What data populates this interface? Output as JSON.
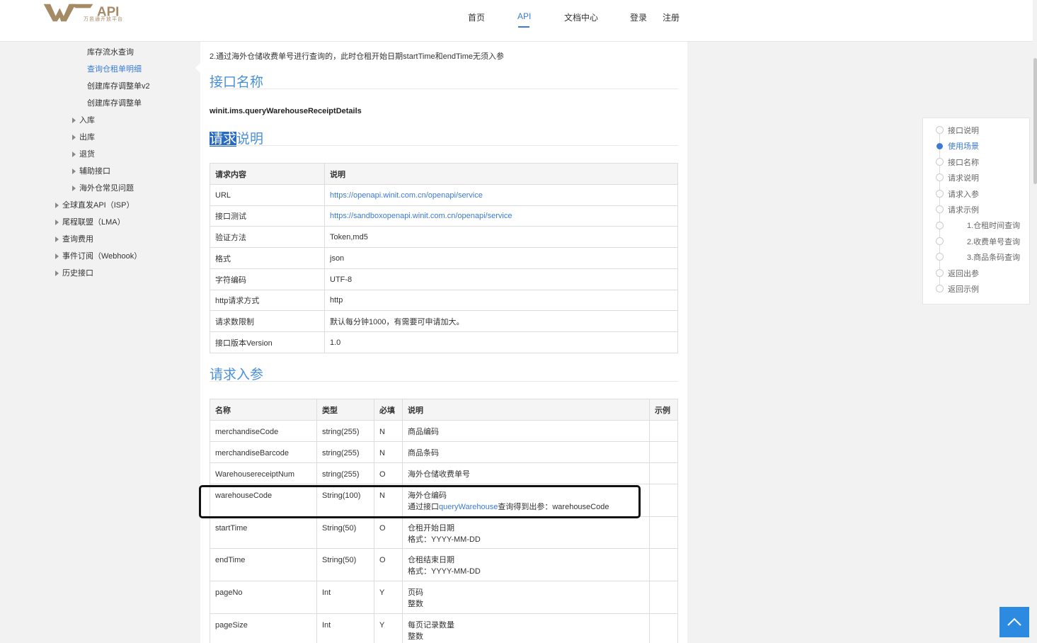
{
  "header": {
    "logo_text": "API",
    "logo_subtitle": "万邑通开放平台",
    "nav": [
      "首页",
      "API",
      "文档中心",
      "登录",
      "注册"
    ]
  },
  "sidebar": {
    "items": [
      {
        "label": "库存流水查询",
        "level": 3
      },
      {
        "label": "查询仓租单明细",
        "level": 3,
        "active": true
      },
      {
        "label": "创建库存调整单v2",
        "level": 3
      },
      {
        "label": "创建库存调整单",
        "level": 3
      },
      {
        "label": "入库",
        "level": 2
      },
      {
        "label": "出库",
        "level": 2
      },
      {
        "label": "退货",
        "level": 2
      },
      {
        "label": "辅助接口",
        "level": 2
      },
      {
        "label": "海外仓常见问题",
        "level": 2
      },
      {
        "label": "全球直发API（ISP）",
        "level": 1
      },
      {
        "label": "尾程联盟（LMA）",
        "level": 1
      },
      {
        "label": "查询费用",
        "level": 1
      },
      {
        "label": "事件订阅（Webhook）",
        "level": 1
      },
      {
        "label": "历史接口",
        "level": 1
      }
    ]
  },
  "content": {
    "intro": "2.通过海外仓储收费单号进行查询的，此时仓租开始日期startTime和endTime无须入参",
    "section_api_name": "接口名称",
    "api_name": "winit.ims.queryWarehouseReceiptDetails",
    "section_request_selected": "请求",
    "section_request_rest": "说明",
    "request_table": {
      "headers": [
        "请求内容",
        "说明"
      ],
      "rows": [
        [
          "URL",
          "https://openapi.winit.com.cn/openapi/service"
        ],
        [
          "接口测试",
          "https://sandboxopenapi.winit.com.cn/openapi/service"
        ],
        [
          "验证方法",
          "Token,md5"
        ],
        [
          "格式",
          "json"
        ],
        [
          "字符编码",
          "UTF-8"
        ],
        [
          "http请求方式",
          "http"
        ],
        [
          "请求数限制",
          "默认每分钟1000，有需要可申请加大。"
        ],
        [
          "接口版本Version",
          "1.0"
        ]
      ]
    },
    "section_params": "请求入参",
    "params_table": {
      "headers": [
        "名称",
        "类型",
        "必填",
        "说明",
        "示例"
      ],
      "rows": [
        {
          "name": "merchandiseCode",
          "type": "string(255)",
          "required": "N",
          "desc1": "商品编码",
          "desc2": "",
          "example": ""
        },
        {
          "name": "merchandiseBarcode",
          "type": "string(255)",
          "required": "N",
          "desc1": "商品条码",
          "desc2": "",
          "example": ""
        },
        {
          "name": "WarehousereceiptNum",
          "type": "string(255)",
          "required": "O",
          "desc1": "海外仓储收费单号",
          "desc2": "",
          "example": ""
        },
        {
          "name": "warehouseCode",
          "type": "String(100)",
          "required": "N",
          "desc1": "海外仓编码",
          "desc2_pre": "通过接口",
          "desc2_link": "queryWarehouse",
          "desc2_post": "查询得到出参：warehouseCode",
          "example": ""
        },
        {
          "name": "startTime",
          "type": "String(50)",
          "required": "O",
          "desc1": "仓租开始日期",
          "desc2": "格式：YYYY-MM-DD",
          "example": ""
        },
        {
          "name": "endTime",
          "type": "String(50)",
          "required": "O",
          "desc1": "仓租结束日期",
          "desc2": "格式：YYYY-MM-DD",
          "example": ""
        },
        {
          "name": "pageNo",
          "type": "Int",
          "required": "Y",
          "desc1": "页码",
          "desc2": "整数",
          "example": ""
        },
        {
          "name": "pageSize",
          "type": "Int",
          "required": "Y",
          "desc1": "每页记录数量",
          "desc2": "整数",
          "example": ""
        }
      ]
    }
  },
  "toc": {
    "items": [
      "接口说明",
      "使用场景",
      "接口名称",
      "请求说明",
      "请求入参",
      "请求示例",
      "1.仓租时间查询",
      "2.收费单号查询",
      "3.商品条码查询",
      "返回出参",
      "返回示例"
    ],
    "active_index": 1
  },
  "colors": {
    "accent": "#3b7bd6",
    "highlight_box": "#111111",
    "back_to_top": "#2c8be0"
  }
}
